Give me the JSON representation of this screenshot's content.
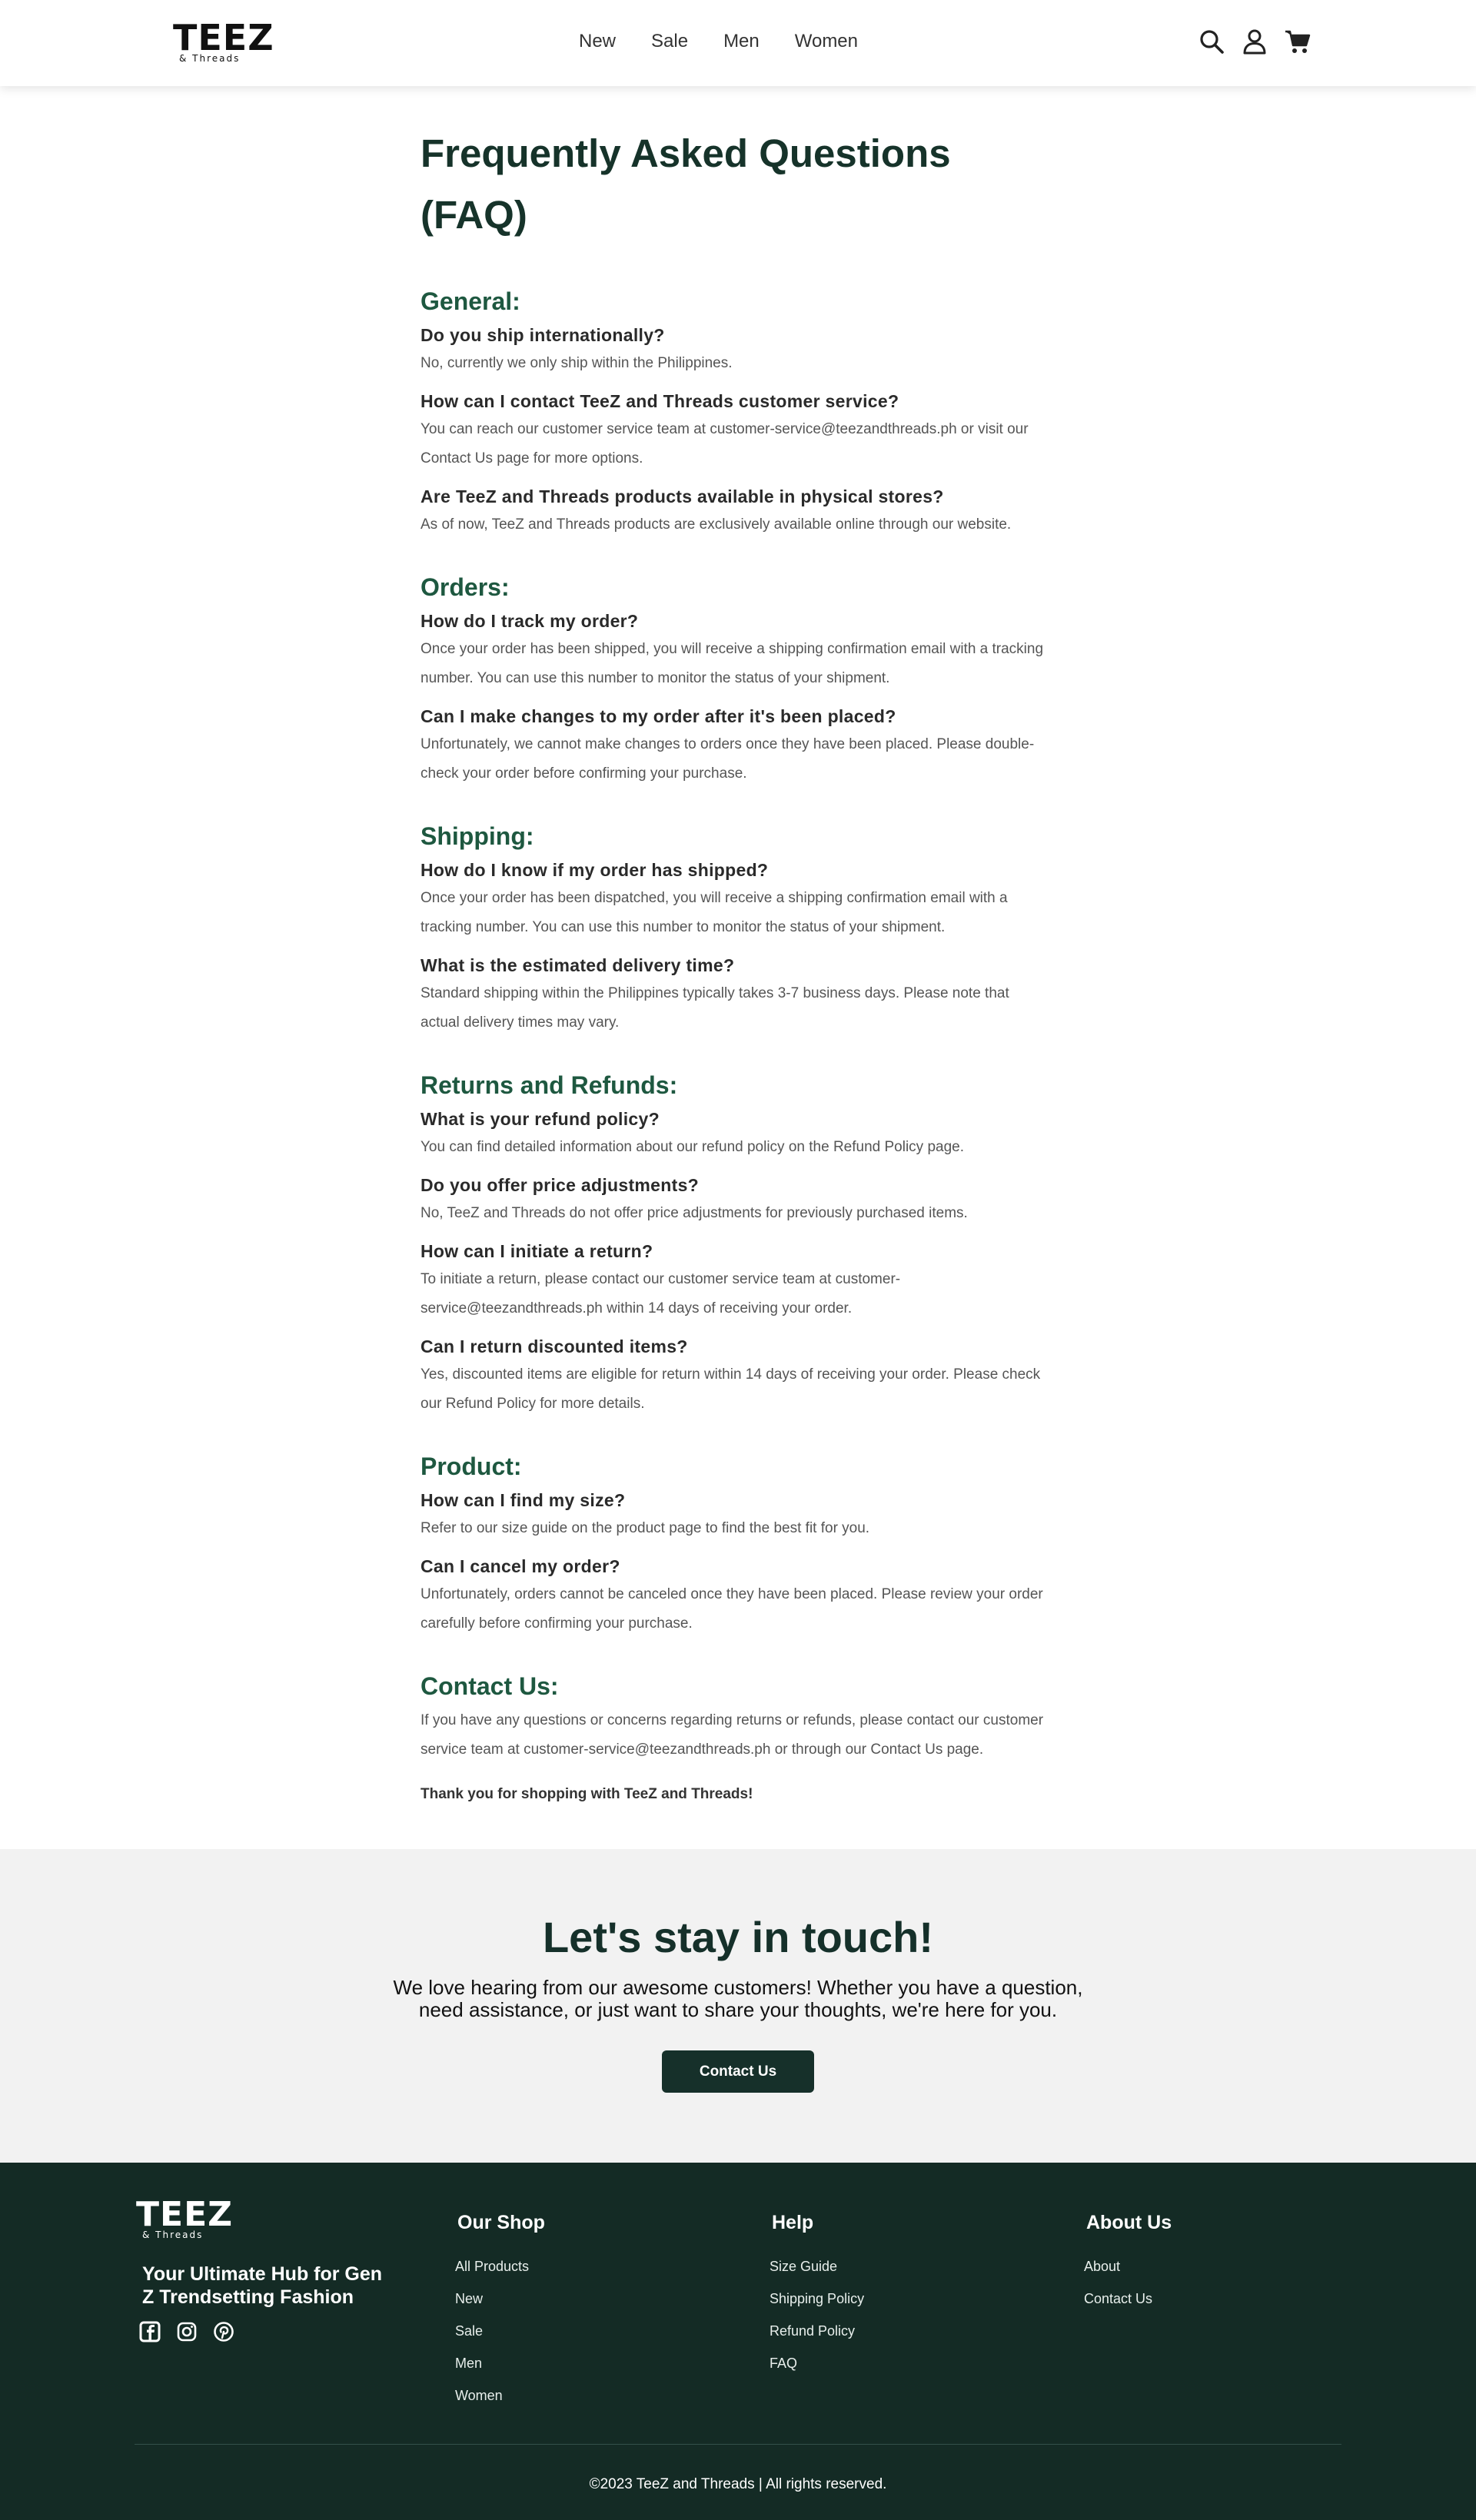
{
  "header": {
    "logo_main": "TEEZ",
    "logo_sub": "& Threads",
    "nav": [
      "New",
      "Sale",
      "Men",
      "Women"
    ],
    "icons": [
      "search-icon",
      "user-icon",
      "cart-icon"
    ]
  },
  "faq": {
    "title": "Frequently Asked Questions (FAQ)",
    "sections": [
      {
        "heading": "General:",
        "items": [
          {
            "q": "Do you ship internationally?",
            "a": "No, currently we only ship within the Philippines."
          },
          {
            "q": "How can I contact TeeZ and Threads customer service?",
            "a": "You can reach our customer service team at customer-service@teezandthreads.ph or visit our Contact Us page for more options."
          },
          {
            "q": "Are TeeZ and Threads products available in physical stores?",
            "a": "As of now, TeeZ and Threads products are exclusively available online through our website."
          }
        ]
      },
      {
        "heading": "Orders:",
        "items": [
          {
            "q": "How do I track my order?",
            "a": "Once your order has been shipped, you will receive a shipping confirmation email with a tracking number. You can use this number to monitor the status of your shipment."
          },
          {
            "q": "Can I make changes to my order after it's been placed?",
            "a": "Unfortunately, we cannot make changes to orders once they have been placed. Please double-check your order before confirming your purchase."
          }
        ]
      },
      {
        "heading": "Shipping:",
        "items": [
          {
            "q": "How do I know if my order has shipped?",
            "a": "Once your order has been dispatched, you will receive a shipping confirmation email with a tracking number. You can use this number to monitor the status of your shipment."
          },
          {
            "q": "What is the estimated delivery time?",
            "a": "Standard shipping within the Philippines typically takes 3-7 business days. Please note that actual delivery times may vary."
          }
        ]
      },
      {
        "heading": "Returns and Refunds:",
        "items": [
          {
            "q": "What is your refund policy?",
            "a": "You can find detailed information about our refund policy on the Refund Policy page."
          },
          {
            "q": "Do you offer price adjustments?",
            "a": "No, TeeZ and Threads do not offer price adjustments for previously purchased items."
          },
          {
            "q": "How can I initiate a return?",
            "a": "To initiate a return, please contact our customer service team at customer-service@teezandthreads.ph within 14 days of receiving your order."
          },
          {
            "q": "Can I return discounted items?",
            "a": "Yes, discounted items are eligible for return within 14 days of receiving your order. Please check our Refund Policy for more details."
          }
        ]
      },
      {
        "heading": "Product:",
        "items": [
          {
            "q": "How can I find my size?",
            "a": "Refer to our size guide on the product page to find the best fit for you."
          },
          {
            "q": "Can I cancel my order?",
            "a": "Unfortunately, orders cannot be canceled once they have been placed. Please review your order carefully before confirming your purchase."
          }
        ]
      }
    ],
    "contact_heading": "Contact Us:",
    "contact_text": "If you have any questions or concerns regarding returns or refunds, please contact our customer service team at customer-service@teezandthreads.ph or through our Contact Us page.",
    "thanks": "Thank you for shopping with TeeZ and Threads!"
  },
  "touch": {
    "title": "Let's stay in touch!",
    "text": "We love hearing from our awesome customers! Whether you have a question, need assistance, or just want to share your thoughts, we're here for you.",
    "button": "Contact Us"
  },
  "footer": {
    "logo_main": "TEEZ",
    "logo_sub": "& Threads",
    "tagline": "Your Ultimate Hub for Gen Z Trendsetting Fashion",
    "socials": [
      "facebook-icon",
      "instagram-icon",
      "pinterest-icon"
    ],
    "columns": [
      {
        "title": "Our Shop",
        "links": [
          "All Products",
          "New",
          "Sale",
          "Men",
          "Women"
        ]
      },
      {
        "title": "Help",
        "links": [
          "Size Guide",
          "Shipping Policy",
          "Refund Policy",
          "FAQ"
        ]
      },
      {
        "title": "About Us",
        "links": [
          "About",
          "Contact Us"
        ]
      }
    ],
    "copyright": "©2023 TeeZ and Threads | All rights reserved."
  }
}
